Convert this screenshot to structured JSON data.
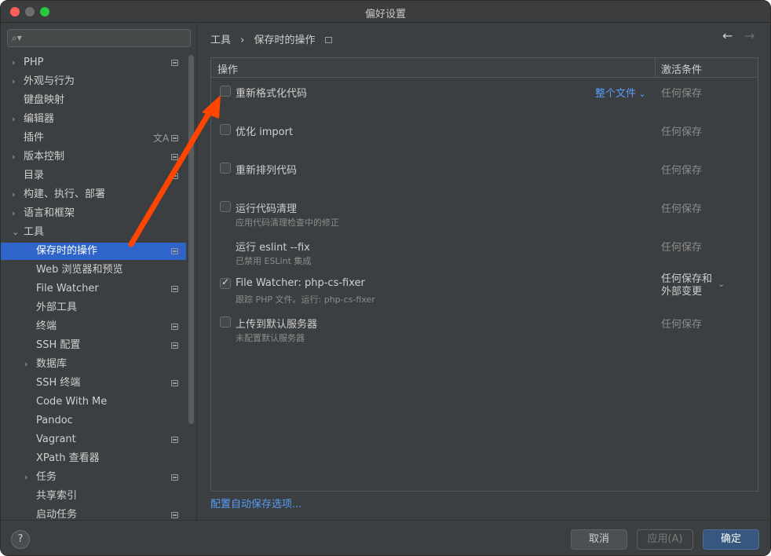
{
  "window": {
    "title": "偏好设置"
  },
  "search": {
    "placeholder": ""
  },
  "sidebar": {
    "items": [
      {
        "label": "PHP",
        "expandable": true,
        "marker": true
      },
      {
        "label": "外观与行为",
        "expandable": true,
        "marker": false
      },
      {
        "label": "键盘映射",
        "expandable": false,
        "marker": false
      },
      {
        "label": "编辑器",
        "expandable": true,
        "marker": false
      },
      {
        "label": "插件",
        "expandable": false,
        "marker": true,
        "translate": true
      },
      {
        "label": "版本控制",
        "expandable": true,
        "marker": true
      },
      {
        "label": "目录",
        "expandable": false,
        "marker": true
      },
      {
        "label": "构建、执行、部署",
        "expandable": true,
        "marker": false
      },
      {
        "label": "语言和框架",
        "expandable": true,
        "marker": false
      },
      {
        "label": "工具",
        "expandable": true,
        "expanded": true,
        "marker": false
      },
      {
        "label": "保存时的操作",
        "child": true,
        "selected": true,
        "marker": true
      },
      {
        "label": "Web 浏览器和预览",
        "child": true,
        "marker": false
      },
      {
        "label": "File Watcher",
        "child": true,
        "marker": true
      },
      {
        "label": "外部工具",
        "child": true,
        "marker": false
      },
      {
        "label": "终端",
        "child": true,
        "marker": true
      },
      {
        "label": "SSH 配置",
        "child": true,
        "marker": true
      },
      {
        "label": "数据库",
        "child": true,
        "expandable": true,
        "marker": false
      },
      {
        "label": "SSH 终端",
        "child": true,
        "marker": true
      },
      {
        "label": "Code With Me",
        "child": true,
        "marker": false
      },
      {
        "label": "Pandoc",
        "child": true,
        "marker": false
      },
      {
        "label": "Vagrant",
        "child": true,
        "marker": true
      },
      {
        "label": "XPath 查看器",
        "child": true,
        "marker": false
      },
      {
        "label": "任务",
        "child": true,
        "expandable": true,
        "marker": true
      },
      {
        "label": "共享索引",
        "child": true,
        "marker": false
      },
      {
        "label": "启动任务",
        "child": true,
        "marker": true
      }
    ]
  },
  "breadcrumb": {
    "parent": "工具",
    "separator": "›",
    "current": "保存时的操作"
  },
  "table": {
    "col_action": "操作",
    "col_condition": "激活条件",
    "rows": [
      {
        "title": "重新格式化代码",
        "subtitle": "",
        "checked": false,
        "scope": "整个文件",
        "condition": "任何保存",
        "checkbox": true
      },
      {
        "title": "优化 import",
        "subtitle": "",
        "checked": false,
        "scope": "",
        "condition": "任何保存",
        "checkbox": true
      },
      {
        "title": "重新排列代码",
        "subtitle": "",
        "checked": false,
        "scope": "",
        "condition": "任何保存",
        "checkbox": true
      },
      {
        "title": "运行代码清理",
        "subtitle": "应用代码清理检查中的修正",
        "checked": false,
        "scope": "",
        "condition": "任何保存",
        "checkbox": true
      },
      {
        "title": "运行 eslint --fix",
        "subtitle": "已禁用 ESLint 集成",
        "checked": false,
        "scope": "",
        "condition": "任何保存",
        "checkbox": false
      },
      {
        "title": "File Watcher: php-cs-fixer",
        "subtitle": "跟踪 PHP 文件。运行: php-cs-fixer",
        "checked": true,
        "scope": "",
        "condition": "任何保存和",
        "condition2": "外部变更",
        "checkbox": true
      },
      {
        "title": "上传到默认服务器",
        "subtitle": "未配置默认服务器",
        "checked": false,
        "scope": "",
        "condition": "任何保存",
        "checkbox": true
      }
    ]
  },
  "config_link": "配置自动保存选项...",
  "footer": {
    "help": "?",
    "cancel": "取消",
    "apply": "应用(A)",
    "ok": "确定"
  },
  "colors": {
    "accent": "#2f65ca",
    "link": "#589df6",
    "annotation_arrow": "#ff4500"
  }
}
